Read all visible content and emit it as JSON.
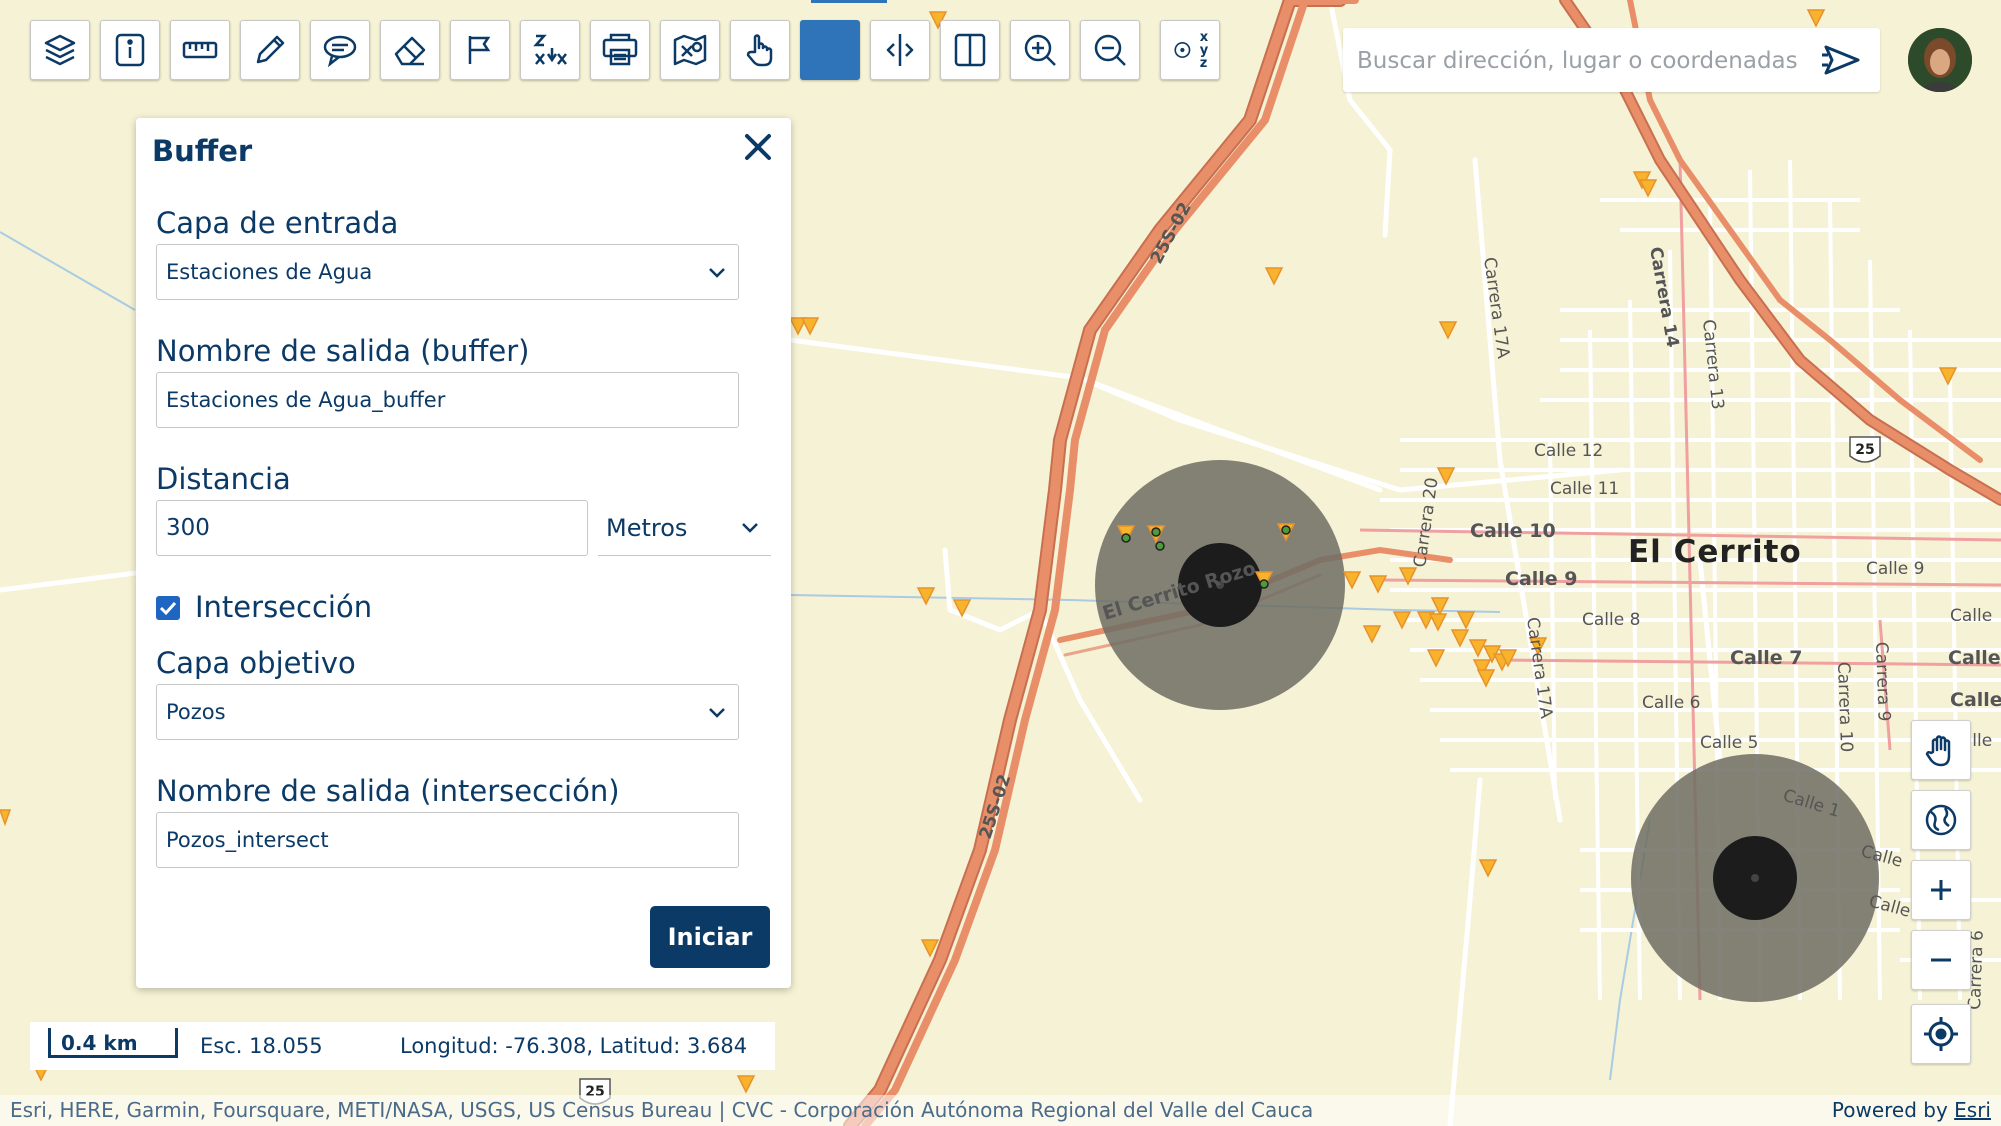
{
  "toolbar": {
    "tools": [
      {
        "name": "layers-icon"
      },
      {
        "name": "info-icon"
      },
      {
        "name": "ruler-icon"
      },
      {
        "name": "pencil-icon"
      },
      {
        "name": "comment-icon"
      },
      {
        "name": "eraser-icon"
      },
      {
        "name": "flag-icon"
      },
      {
        "name": "sort-az-icon"
      },
      {
        "name": "print-icon"
      },
      {
        "name": "map-off-icon"
      },
      {
        "name": "hand-pointer-icon"
      },
      {
        "name": "active-tool"
      },
      {
        "name": "swipe-icon"
      },
      {
        "name": "split-view-icon"
      },
      {
        "name": "zoom-in-icon"
      },
      {
        "name": "zoom-out-icon"
      },
      {
        "name": "xyz-coordinates-icon"
      }
    ],
    "xyz_label": [
      "x",
      "y",
      "z"
    ]
  },
  "search": {
    "placeholder": "Buscar dirección, lugar o coordenadas"
  },
  "panel": {
    "title": "Buffer",
    "input_layer_label": "Capa de entrada",
    "input_layer_value": "Estaciones de Agua",
    "buffer_output_label": "Nombre de salida (buffer)",
    "buffer_output_value": "Estaciones de Agua_buffer",
    "distance_label": "Distancia",
    "distance_value": "300",
    "distance_unit": "Metros",
    "intersection_label": "Intersección",
    "intersection_checked": true,
    "target_layer_label": "Capa objetivo",
    "target_layer_value": "Pozos",
    "intersect_output_label": "Nombre de salida (intersección)",
    "intersect_output_value": "Pozos_intersect",
    "start_button": "Iniciar"
  },
  "map": {
    "city_label": "El Cerrito",
    "road_labels": {
      "road_25s02_a": "25S-02",
      "road_25s02_b": "25S-02",
      "el_cerrito_rozo": "El Cerrito Rozo",
      "calle_12": "Calle 12",
      "calle_11": "Calle 11",
      "calle_10": "Calle 10",
      "calle_9": "Calle 9",
      "calle_9_east": "Calle 9",
      "calle_8": "Calle 8",
      "calle_7": "Calle 7",
      "calle_7_east": "Calle",
      "calle_6": "Calle 6",
      "calle_6_east": "Calle",
      "calle_5": "Calle 5",
      "calle_1": "Calle 1",
      "calle_east_1": "Calle",
      "calle_east_2": "Calle",
      "calle_east_3": "Calle",
      "calle_east_4": "Calle",
      "carrera_17a_top": "Carrera 17A",
      "carrera_17a_bottom": "Carrera 17A",
      "carrera_14": "Carrera 14",
      "carrera_13": "Carrera 13",
      "carrera_10": "Carrera 10",
      "carrera_9": "Carrera 9",
      "carrera_20": "Carrera 20",
      "carrera_6": "Carrera 6",
      "highway_25_shield": "25",
      "highway_25_shield_bottom": "25"
    }
  },
  "status": {
    "scale_label": "0.4 km",
    "scale_text": "Esc. 18.055",
    "coordinates": "Longitud: -76.308, Latitud: 3.684"
  },
  "attribution": {
    "text": "Esri, HERE, Garmin, Foursquare, METI/NASA, USGS, US Census Bureau | CVC - Corporación Autónoma Regional del Valle del Cauca",
    "powered_by": "Powered by",
    "powered_link": "Esri"
  },
  "colors": {
    "primary": "#0c3a66",
    "accent_blue": "#2f73b8",
    "map_bg": "#f6f2d5",
    "highway": "#e88f6a",
    "marker": "#f7b32b",
    "buffer": "#6d6d63"
  }
}
